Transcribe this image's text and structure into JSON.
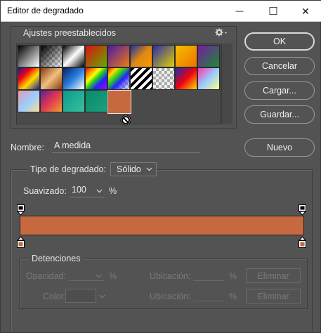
{
  "window": {
    "title": "Editor de degradado"
  },
  "titlebar_buttons": {
    "minimize": "—",
    "maximize": "☐",
    "close": "✕"
  },
  "presets": {
    "label": "Ajustes preestablecidos",
    "menu_icon": "gear-icon"
  },
  "buttons": {
    "ok": "OK",
    "cancel": "Cancelar",
    "load": "Cargar...",
    "save": "Guardar...",
    "new": "Nuevo"
  },
  "name": {
    "label": "Nombre:",
    "value": "A medida"
  },
  "gradient_type": {
    "label": "Tipo de degradado:",
    "value": "Sólido"
  },
  "smoothness": {
    "label": "Suavizado:",
    "value": "100",
    "unit": "%"
  },
  "stops": {
    "label": "Detenciones",
    "opacity_label": "Opacidad:",
    "opacity_unit": "%",
    "location_label": "Ubicación:",
    "location_unit": "%",
    "color_label": "Color:",
    "delete_label": "Eliminar",
    "location_label_2": "Ubicación:",
    "location_unit_2": "%",
    "delete_label_2": "Eliminar"
  },
  "gradient": {
    "left_color": "#c6693e",
    "right_color": "#c6693e"
  }
}
